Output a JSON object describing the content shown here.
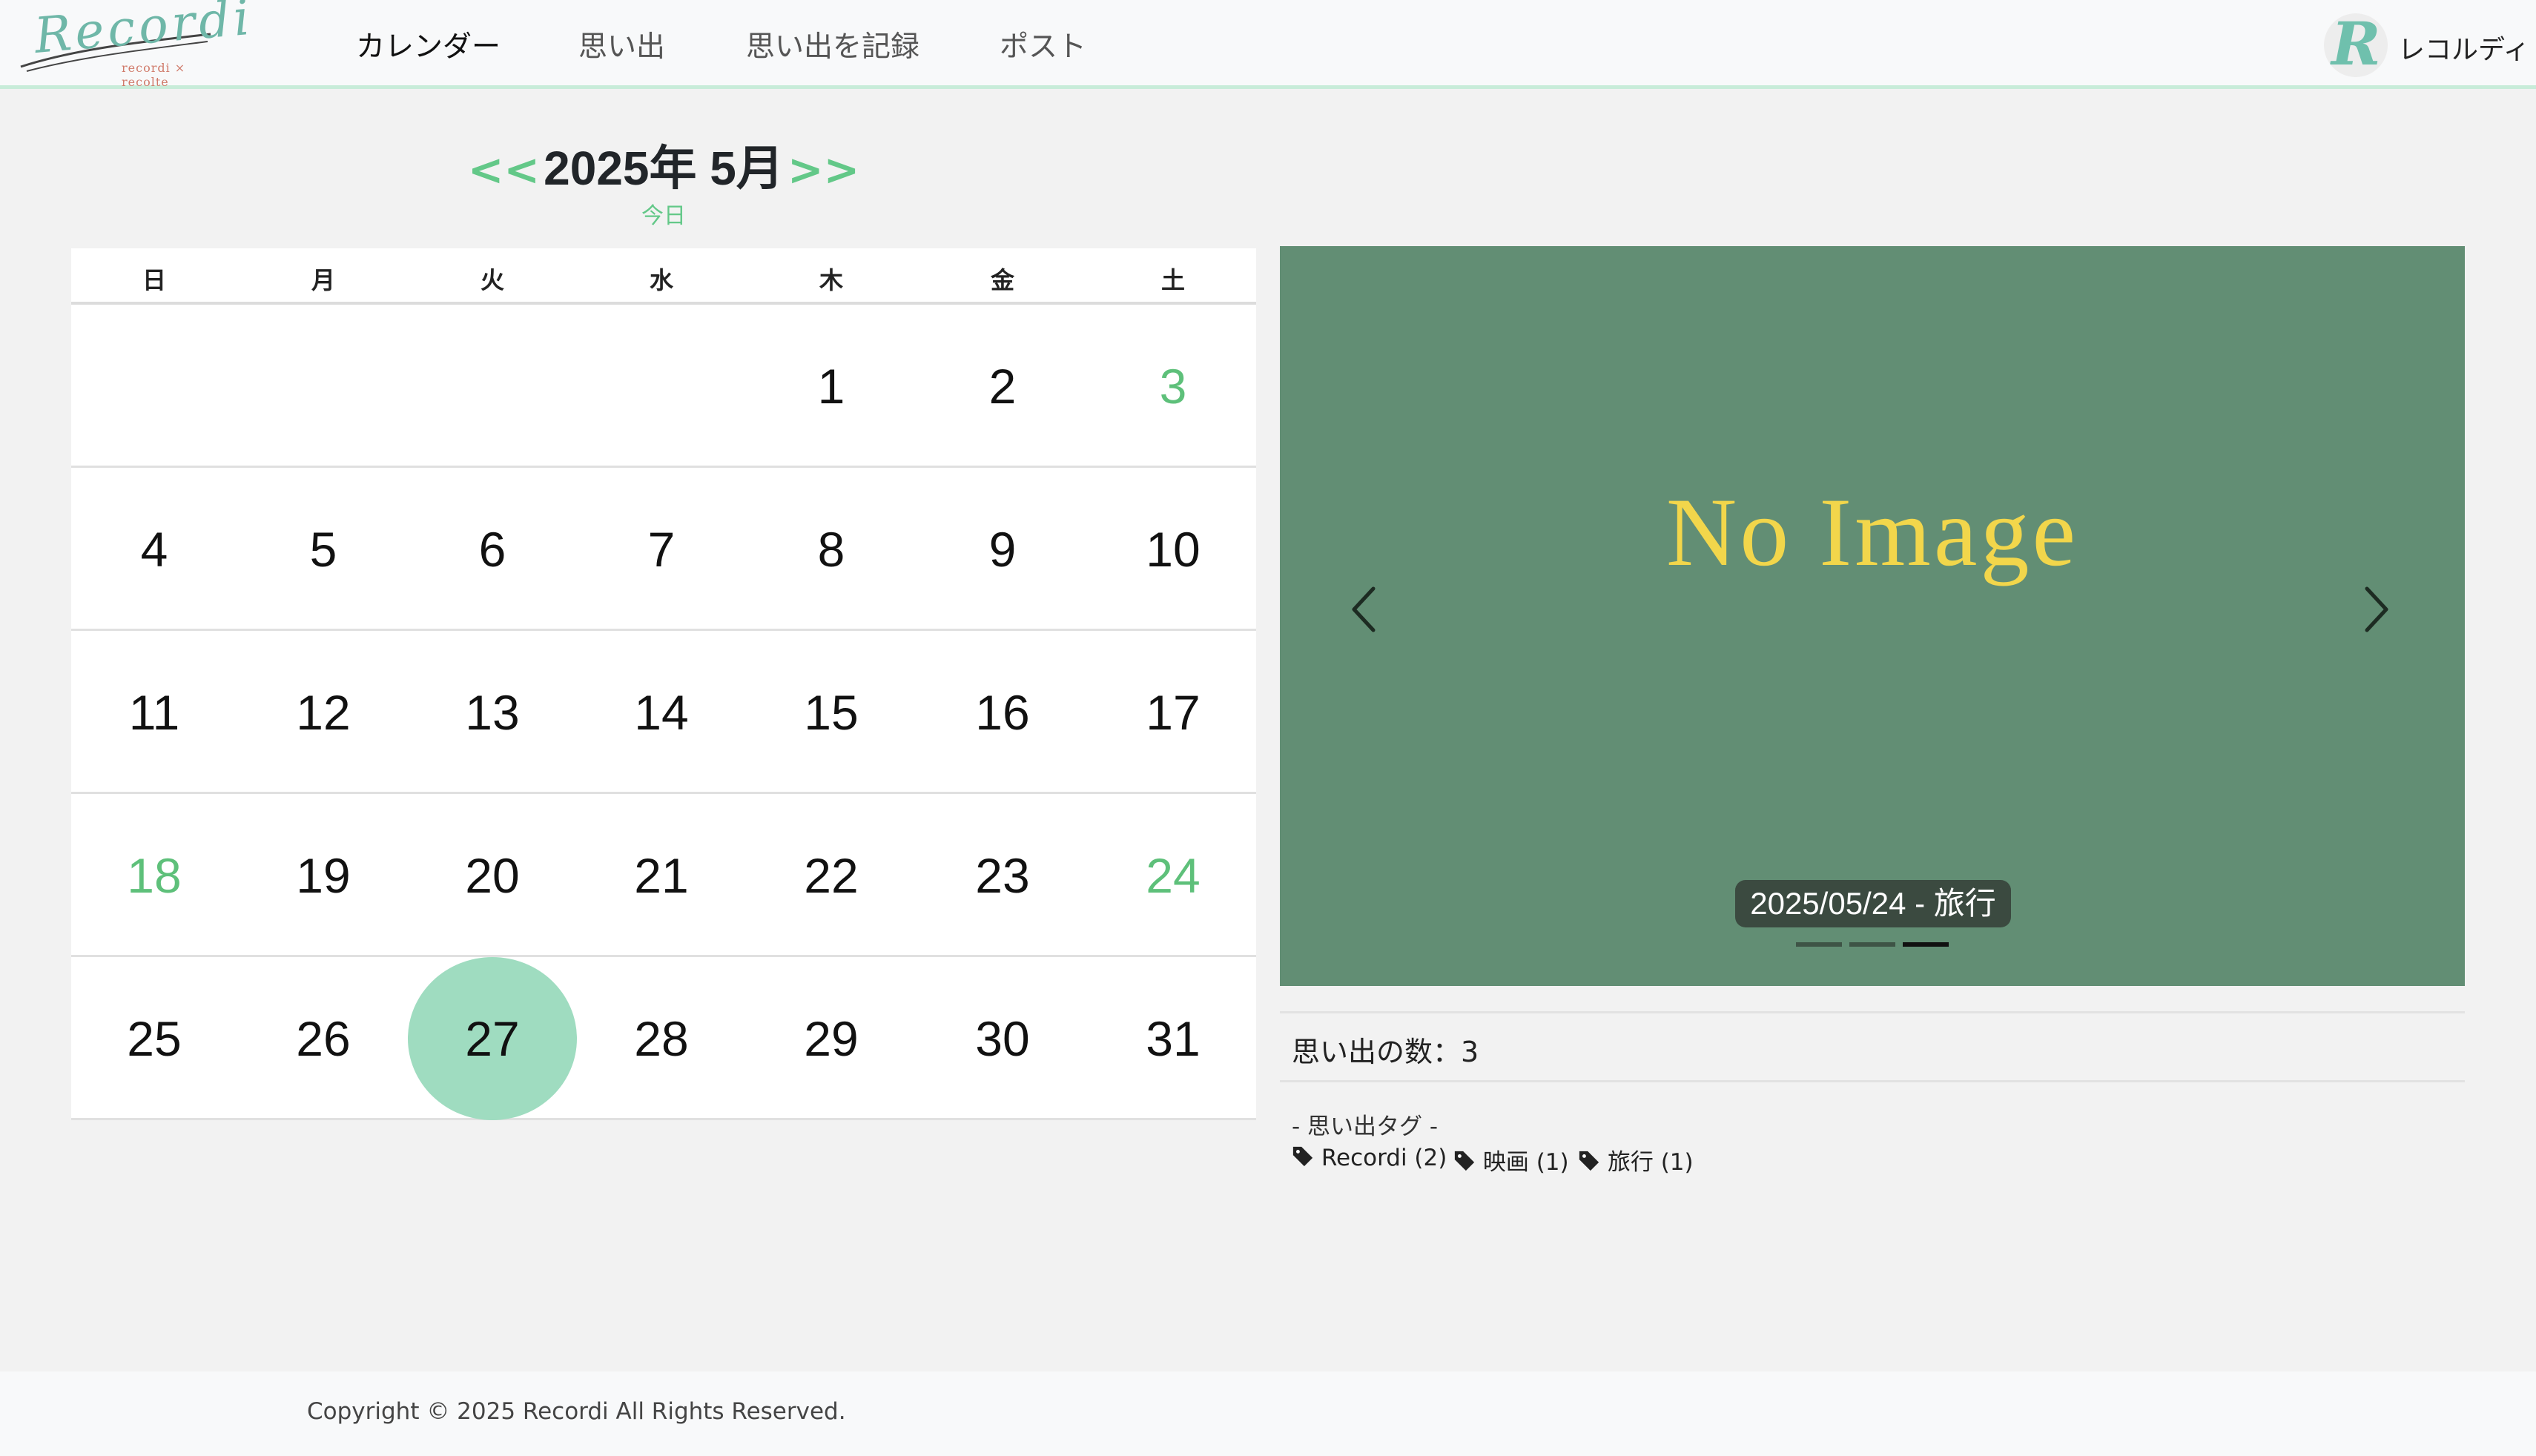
{
  "app": {
    "logo_text": "Recordi",
    "logo_sub": "recordi × recolte",
    "nav": [
      {
        "label": "カレンダー",
        "active": true
      },
      {
        "label": "思い出",
        "active": false
      },
      {
        "label": "思い出を記録",
        "active": false
      },
      {
        "label": "ポスト",
        "active": false
      }
    ],
    "user": {
      "avatar_letter": "R",
      "name": "レコルディ"
    }
  },
  "calendar": {
    "prev": "<<",
    "next": ">>",
    "title": "2025年 5月",
    "today_label": "今日",
    "weekdays": [
      "日",
      "月",
      "火",
      "水",
      "木",
      "金",
      "土"
    ],
    "weeks": [
      [
        "",
        "",
        "",
        "",
        "1",
        "2",
        "3"
      ],
      [
        "4",
        "5",
        "6",
        "7",
        "8",
        "9",
        "10"
      ],
      [
        "11",
        "12",
        "13",
        "14",
        "15",
        "16",
        "17"
      ],
      [
        "18",
        "19",
        "20",
        "21",
        "22",
        "23",
        "24"
      ],
      [
        "25",
        "26",
        "27",
        "28",
        "29",
        "30",
        "31"
      ]
    ],
    "today": "27",
    "marked_days": [
      "3",
      "18",
      "24"
    ],
    "accent_color": "#63c888",
    "today_color": "#9fdcc0"
  },
  "carousel": {
    "placeholder": "No Image",
    "caption": "2025/05/24 - 旅行",
    "slide_count": 3,
    "active_slide": 3,
    "bg_color": "#628e74",
    "placeholder_color": "#f2d64b",
    "prev_icon": "chevron-left-icon",
    "next_icon": "chevron-right-icon"
  },
  "memories": {
    "count_label": "思い出の数：3",
    "tags_title": "- 思い出タグ -",
    "tags": [
      "Recordi (2)",
      "映画 (1)",
      "旅行 (1)"
    ],
    "tag_icon": "tag-icon"
  },
  "footer": {
    "copyright": "Copyright © 2025 Recordi All Rights Reserved."
  }
}
